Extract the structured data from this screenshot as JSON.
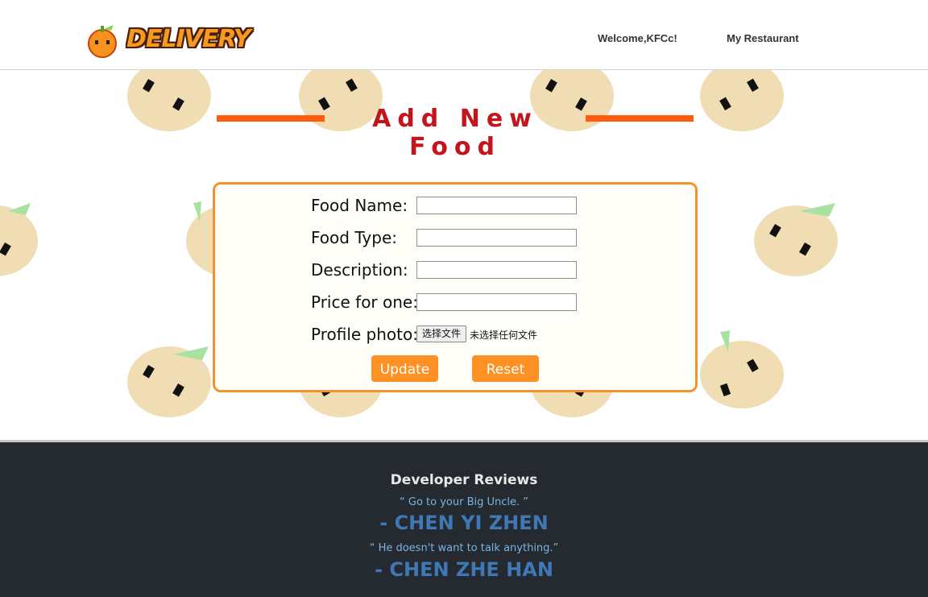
{
  "header": {
    "logo_text": "DELIVERY",
    "welcome": "Welcome,KFCc!",
    "nav_restaurant": "My Restaurant"
  },
  "page": {
    "title": "Add New Food"
  },
  "form": {
    "fields": [
      {
        "label": "Food Name:",
        "value": ""
      },
      {
        "label": "Food Type:",
        "value": ""
      },
      {
        "label": "Description:",
        "value": ""
      },
      {
        "label": "Price for one:",
        "value": ""
      }
    ],
    "photo_label": "Profile photo:",
    "file_button": "选择文件",
    "file_status": "未选择任何文件",
    "update_button": "Update",
    "reset_button": "Reset"
  },
  "footer": {
    "title": "Developer Reviews",
    "reviews": [
      {
        "quote": "“ Go to your Big Uncle. ”",
        "author": "- CHEN YI ZHEN"
      },
      {
        "quote": "“ He doesn't want to talk anything.”",
        "author": "- CHEN ZHE HAN"
      }
    ]
  },
  "colors": {
    "accent_orange": "#ff9124",
    "title_red": "#c4151c",
    "line_orange": "#ff5a0e",
    "footer_bg": "#252a31"
  }
}
